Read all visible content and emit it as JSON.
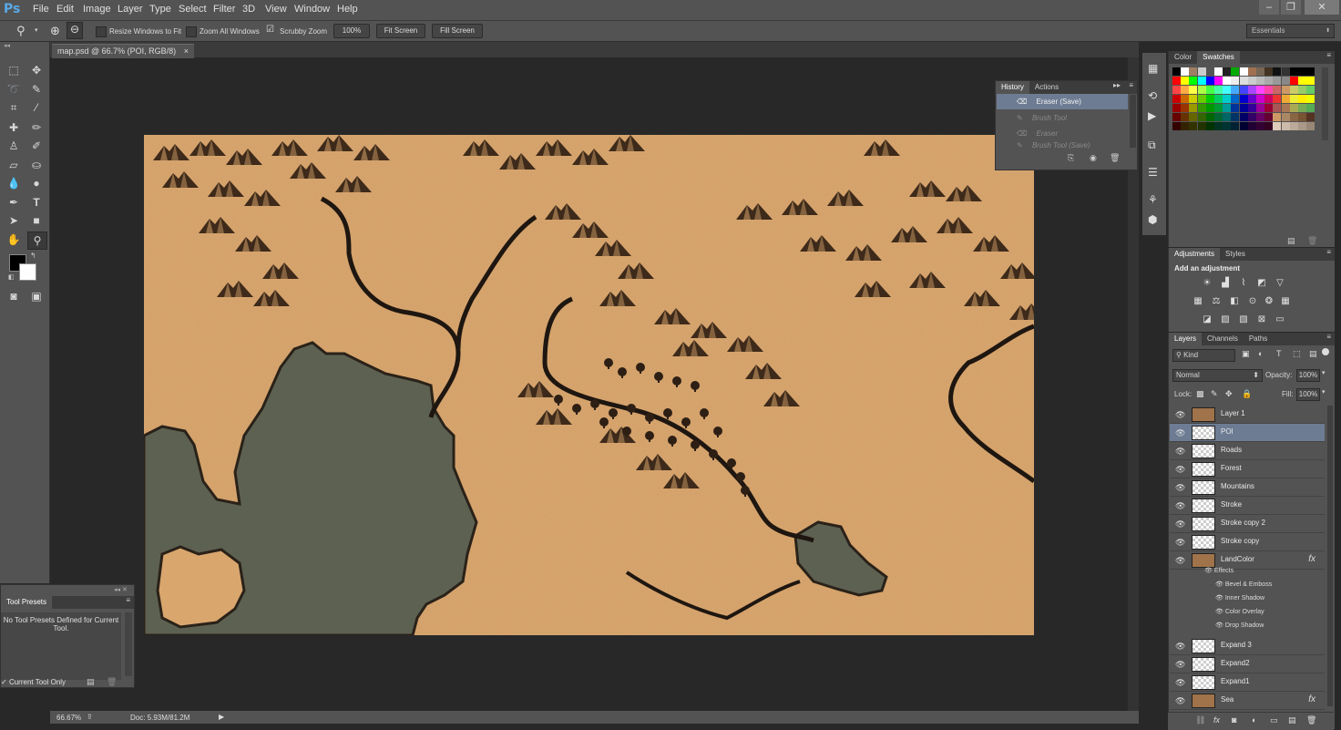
{
  "app": {
    "logo": "Ps"
  },
  "menu": [
    "File",
    "Edit",
    "Image",
    "Layer",
    "Type",
    "Select",
    "Filter",
    "3D",
    "View",
    "Window",
    "Help"
  ],
  "window_controls": {
    "minimize": "‒",
    "restore": "❐",
    "close": "✕"
  },
  "options": {
    "resize_windows": "Resize Windows to Fit",
    "zoom_all": "Zoom All Windows",
    "scrubby": "Scrubby Zoom",
    "zoom_value": "100%",
    "fit_screen": "Fit Screen",
    "fill_screen": "Fill Screen",
    "workspace": "Essentials"
  },
  "document": {
    "tab_title": "map.psd @ 66.7% (POI, RGB/8)",
    "close": "×"
  },
  "status": {
    "zoom": "66.67%",
    "doc": "Doc: 5.93M/81.2M"
  },
  "history": {
    "tabs": [
      "History",
      "Actions"
    ],
    "items": [
      {
        "label": "Eraser (Save)",
        "state": "active"
      },
      {
        "label": "Brush Tool",
        "state": "dim"
      },
      {
        "label": "Eraser",
        "state": "dim"
      },
      {
        "label": "Brush Tool (Save)",
        "state": "dim"
      }
    ]
  },
  "swatches": {
    "tabs": [
      "Color",
      "Swatches"
    ]
  },
  "adjustments": {
    "tabs": [
      "Adjustments",
      "Styles"
    ],
    "heading": "Add an adjustment"
  },
  "layers": {
    "tabs": [
      "Layers",
      "Channels",
      "Paths"
    ],
    "kind": "Kind",
    "blend_mode": "Normal",
    "opacity_label": "Opacity:",
    "opacity": "100%",
    "lock_label": "Lock:",
    "fill_label": "Fill:",
    "fill": "100%",
    "items": [
      {
        "name": "Layer 1",
        "thumb": "#a0734a",
        "fx": ""
      },
      {
        "name": "POI",
        "thumb": "checker",
        "fx": "",
        "selected": true
      },
      {
        "name": "Roads",
        "thumb": "checker",
        "fx": ""
      },
      {
        "name": "Forest",
        "thumb": "checker",
        "fx": ""
      },
      {
        "name": "Mountains",
        "thumb": "checker",
        "fx": ""
      },
      {
        "name": "Stroke",
        "thumb": "checker",
        "fx": ""
      },
      {
        "name": "Stroke copy 2",
        "thumb": "checker",
        "fx": ""
      },
      {
        "name": "Stroke copy",
        "thumb": "checker",
        "fx": ""
      },
      {
        "name": "LandColor",
        "thumb": "#a0734a",
        "fx": "fx"
      }
    ],
    "effects_label": "Effects",
    "effects": [
      "Bevel & Emboss",
      "Inner Shadow",
      "Color Overlay",
      "Drop Shadow"
    ],
    "items_after": [
      {
        "name": "Expand 3",
        "thumb": "checker",
        "fx": ""
      },
      {
        "name": "Expand2",
        "thumb": "checker",
        "fx": ""
      },
      {
        "name": "Expand1",
        "thumb": "checker",
        "fx": ""
      },
      {
        "name": "Sea",
        "thumb": "#a0734a",
        "fx": "fx"
      }
    ]
  },
  "tool_presets": {
    "title": "Tool Presets",
    "message": "No Tool Presets Defined for Current Tool.",
    "checkbox": "Current Tool Only"
  },
  "colors": {
    "parchment": "#d9a66e",
    "sea": "#5d6152",
    "panel": "#535353",
    "selected_layer": "#6d7c93"
  }
}
